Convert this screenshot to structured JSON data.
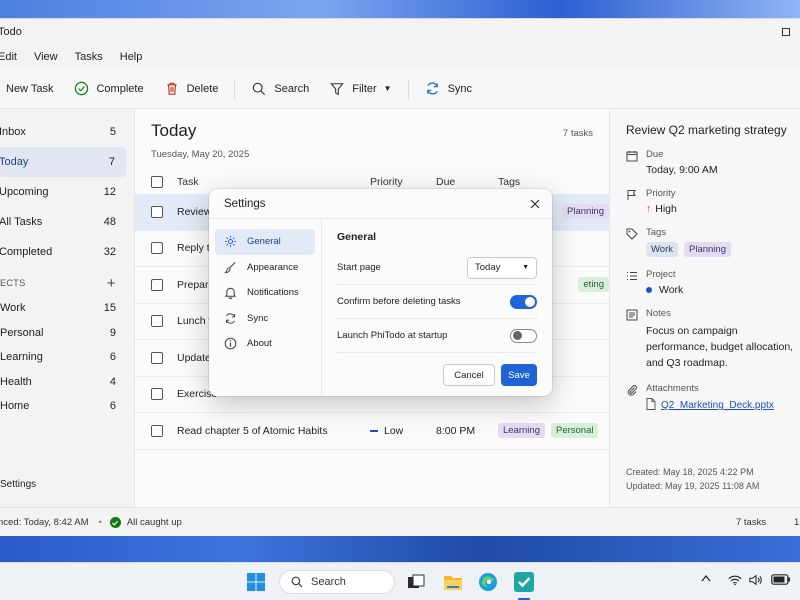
{
  "window": {
    "title": "Todo"
  },
  "menu": [
    "Edit",
    "View",
    "Tasks",
    "Help"
  ],
  "toolbar": {
    "new_task": "New Task",
    "complete": "Complete",
    "delete": "Delete",
    "search": "Search",
    "filter": "Filter",
    "sync": "Sync"
  },
  "sidebar": {
    "items": [
      {
        "label": "Inbox",
        "count": "5"
      },
      {
        "label": "Today",
        "count": "7"
      },
      {
        "label": "Upcoming",
        "count": "12"
      },
      {
        "label": "All Tasks",
        "count": "48"
      },
      {
        "label": "Completed",
        "count": "32"
      }
    ],
    "projects_heading": "ECTS",
    "projects": [
      {
        "label": "Work",
        "count": "15"
      },
      {
        "label": "Personal",
        "count": "9"
      },
      {
        "label": "Learning",
        "count": "6"
      },
      {
        "label": "Health",
        "count": "4"
      },
      {
        "label": "Home",
        "count": "6"
      }
    ],
    "settings": "Settings"
  },
  "main": {
    "title": "Today",
    "count": "7 tasks",
    "date": "Tuesday, May 20, 2025",
    "columns": {
      "task": "Task",
      "priority": "Priority",
      "due": "Due",
      "tags": "Tags"
    },
    "rows": [
      {
        "task": "Review",
        "priority": "",
        "due": "",
        "tags": [
          {
            "label": "Planning",
            "color": "purple"
          }
        ],
        "selected": true
      },
      {
        "task": "Reply to",
        "priority": "",
        "due": "",
        "tags": []
      },
      {
        "task": "Prepare",
        "priority": "",
        "due": "",
        "tags": [
          {
            "label": "eting",
            "color": "green"
          }
        ]
      },
      {
        "task": "Lunch w",
        "priority": "",
        "due": "",
        "tags": []
      },
      {
        "task": "Update",
        "priority": "",
        "due": "",
        "tags": []
      },
      {
        "task": "Exercise",
        "priority": "",
        "due": "",
        "tags": []
      },
      {
        "task": "Read chapter 5 of Atomic Habits",
        "priority": "Low",
        "due": "8:00 PM",
        "tags": [
          {
            "label": "Learning",
            "color": "purple"
          },
          {
            "label": "Personal",
            "color": "green"
          }
        ]
      }
    ]
  },
  "details": {
    "title": "Review Q2 marketing strategy",
    "due_label": "Due",
    "due_value": "Today, 9:00 AM",
    "priority_label": "Priority",
    "priority_value": "High",
    "tags_label": "Tags",
    "tags": [
      "Work",
      "Planning"
    ],
    "project_label": "Project",
    "project_value": "Work",
    "notes_label": "Notes",
    "notes_value": "Focus on campaign performance, budget allocation, and Q3 roadmap.",
    "attachments_label": "Attachments",
    "attachment": "Q2_Marketing_Deck.pptx",
    "created": "Created: May 18, 2025 4:22 PM",
    "updated": "Updated: May 19, 2025 11:08 AM"
  },
  "status": {
    "synced": "nced: Today, 8:42 AM",
    "caught_up": "All caught up",
    "tasks": "7 tasks",
    "extra": "1"
  },
  "modal": {
    "title": "Settings",
    "nav": [
      "General",
      "Appearance",
      "Notifications",
      "Sync",
      "About"
    ],
    "section": "General",
    "start_page_label": "Start page",
    "start_page_value": "Today",
    "confirm_delete_label": "Confirm before deleting tasks",
    "confirm_delete_on": true,
    "launch_label": "Launch PhiTodo at startup",
    "launch_on": false,
    "cancel": "Cancel",
    "save": "Save"
  },
  "taskbar": {
    "search": "Search"
  },
  "colors": {
    "accent": "#1f63d6",
    "high_priority": "#d13438",
    "success": "#0f7b0f"
  }
}
